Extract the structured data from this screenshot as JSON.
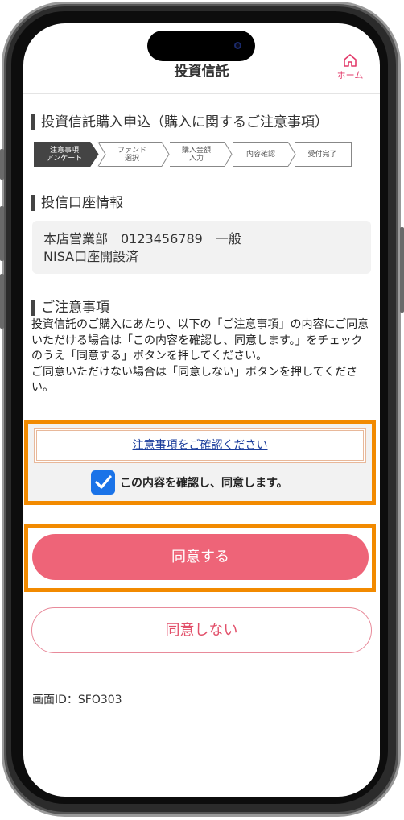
{
  "header": {
    "title": "投資信託",
    "home_label": "ホーム"
  },
  "page_title": "投資信託購入申込（購入に関するご注意事項）",
  "steps": [
    {
      "line1": "注意事項",
      "line2": "アンケート",
      "active": true
    },
    {
      "line1": "ファンド",
      "line2": "選択",
      "active": false
    },
    {
      "line1": "購入金額",
      "line2": "入力",
      "active": false
    },
    {
      "line1": "内容確認",
      "line2": "",
      "active": false
    },
    {
      "line1": "受付完了",
      "line2": "",
      "active": false
    }
  ],
  "account_section": {
    "title": "投信口座情報",
    "line1": "本店営業部　0123456789　一般",
    "line2": "NISA口座開設済"
  },
  "notice_section": {
    "title": "ご注意事項",
    "paragraph1": "投資信託のご購入にあたり、以下の「ご注意事項」の内容にご同意いただける場合は「この内容を確認し、同意します。」をチェックのうえ「同意する」ボタンを押してください。",
    "paragraph2": "ご同意いただけない場合は「同意しない」ボタンを押してください。"
  },
  "confirm": {
    "link_text": "注意事項をご確認ください",
    "checkbox_label": "この内容を確認し、同意します。",
    "checked": true
  },
  "buttons": {
    "agree": "同意する",
    "disagree": "同意しない"
  },
  "screen_id": "画面ID：SFO303",
  "colors": {
    "accent": "#ee6478",
    "highlight": "#f28a00",
    "checkbox": "#1a73e8",
    "link": "#1b3d9c",
    "active_step": "#444444"
  },
  "icons": {
    "home": "home-icon",
    "check": "checkmark-icon"
  }
}
